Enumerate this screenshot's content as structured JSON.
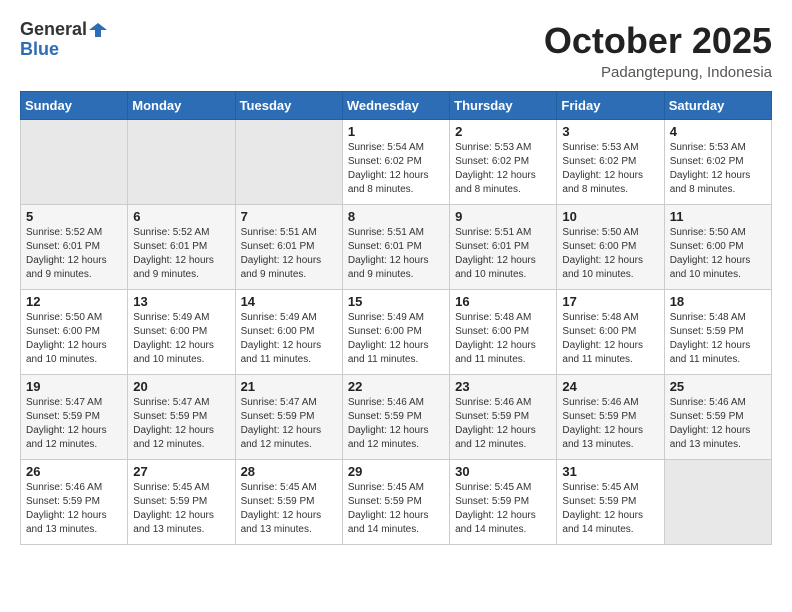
{
  "header": {
    "logo": {
      "general": "General",
      "blue": "Blue"
    },
    "title": "October 2025",
    "subtitle": "Padangtepung, Indonesia"
  },
  "weekdays": [
    "Sunday",
    "Monday",
    "Tuesday",
    "Wednesday",
    "Thursday",
    "Friday",
    "Saturday"
  ],
  "weeks": [
    [
      {
        "day": "",
        "empty": true
      },
      {
        "day": "",
        "empty": true
      },
      {
        "day": "",
        "empty": true
      },
      {
        "day": "1",
        "sunrise": "Sunrise: 5:54 AM",
        "sunset": "Sunset: 6:02 PM",
        "daylight": "Daylight: 12 hours and 8 minutes."
      },
      {
        "day": "2",
        "sunrise": "Sunrise: 5:53 AM",
        "sunset": "Sunset: 6:02 PM",
        "daylight": "Daylight: 12 hours and 8 minutes."
      },
      {
        "day": "3",
        "sunrise": "Sunrise: 5:53 AM",
        "sunset": "Sunset: 6:02 PM",
        "daylight": "Daylight: 12 hours and 8 minutes."
      },
      {
        "day": "4",
        "sunrise": "Sunrise: 5:53 AM",
        "sunset": "Sunset: 6:02 PM",
        "daylight": "Daylight: 12 hours and 8 minutes."
      }
    ],
    [
      {
        "day": "5",
        "sunrise": "Sunrise: 5:52 AM",
        "sunset": "Sunset: 6:01 PM",
        "daylight": "Daylight: 12 hours and 9 minutes."
      },
      {
        "day": "6",
        "sunrise": "Sunrise: 5:52 AM",
        "sunset": "Sunset: 6:01 PM",
        "daylight": "Daylight: 12 hours and 9 minutes."
      },
      {
        "day": "7",
        "sunrise": "Sunrise: 5:51 AM",
        "sunset": "Sunset: 6:01 PM",
        "daylight": "Daylight: 12 hours and 9 minutes."
      },
      {
        "day": "8",
        "sunrise": "Sunrise: 5:51 AM",
        "sunset": "Sunset: 6:01 PM",
        "daylight": "Daylight: 12 hours and 9 minutes."
      },
      {
        "day": "9",
        "sunrise": "Sunrise: 5:51 AM",
        "sunset": "Sunset: 6:01 PM",
        "daylight": "Daylight: 12 hours and 10 minutes."
      },
      {
        "day": "10",
        "sunrise": "Sunrise: 5:50 AM",
        "sunset": "Sunset: 6:00 PM",
        "daylight": "Daylight: 12 hours and 10 minutes."
      },
      {
        "day": "11",
        "sunrise": "Sunrise: 5:50 AM",
        "sunset": "Sunset: 6:00 PM",
        "daylight": "Daylight: 12 hours and 10 minutes."
      }
    ],
    [
      {
        "day": "12",
        "sunrise": "Sunrise: 5:50 AM",
        "sunset": "Sunset: 6:00 PM",
        "daylight": "Daylight: 12 hours and 10 minutes."
      },
      {
        "day": "13",
        "sunrise": "Sunrise: 5:49 AM",
        "sunset": "Sunset: 6:00 PM",
        "daylight": "Daylight: 12 hours and 10 minutes."
      },
      {
        "day": "14",
        "sunrise": "Sunrise: 5:49 AM",
        "sunset": "Sunset: 6:00 PM",
        "daylight": "Daylight: 12 hours and 11 minutes."
      },
      {
        "day": "15",
        "sunrise": "Sunrise: 5:49 AM",
        "sunset": "Sunset: 6:00 PM",
        "daylight": "Daylight: 12 hours and 11 minutes."
      },
      {
        "day": "16",
        "sunrise": "Sunrise: 5:48 AM",
        "sunset": "Sunset: 6:00 PM",
        "daylight": "Daylight: 12 hours and 11 minutes."
      },
      {
        "day": "17",
        "sunrise": "Sunrise: 5:48 AM",
        "sunset": "Sunset: 6:00 PM",
        "daylight": "Daylight: 12 hours and 11 minutes."
      },
      {
        "day": "18",
        "sunrise": "Sunrise: 5:48 AM",
        "sunset": "Sunset: 5:59 PM",
        "daylight": "Daylight: 12 hours and 11 minutes."
      }
    ],
    [
      {
        "day": "19",
        "sunrise": "Sunrise: 5:47 AM",
        "sunset": "Sunset: 5:59 PM",
        "daylight": "Daylight: 12 hours and 12 minutes."
      },
      {
        "day": "20",
        "sunrise": "Sunrise: 5:47 AM",
        "sunset": "Sunset: 5:59 PM",
        "daylight": "Daylight: 12 hours and 12 minutes."
      },
      {
        "day": "21",
        "sunrise": "Sunrise: 5:47 AM",
        "sunset": "Sunset: 5:59 PM",
        "daylight": "Daylight: 12 hours and 12 minutes."
      },
      {
        "day": "22",
        "sunrise": "Sunrise: 5:46 AM",
        "sunset": "Sunset: 5:59 PM",
        "daylight": "Daylight: 12 hours and 12 minutes."
      },
      {
        "day": "23",
        "sunrise": "Sunrise: 5:46 AM",
        "sunset": "Sunset: 5:59 PM",
        "daylight": "Daylight: 12 hours and 12 minutes."
      },
      {
        "day": "24",
        "sunrise": "Sunrise: 5:46 AM",
        "sunset": "Sunset: 5:59 PM",
        "daylight": "Daylight: 12 hours and 13 minutes."
      },
      {
        "day": "25",
        "sunrise": "Sunrise: 5:46 AM",
        "sunset": "Sunset: 5:59 PM",
        "daylight": "Daylight: 12 hours and 13 minutes."
      }
    ],
    [
      {
        "day": "26",
        "sunrise": "Sunrise: 5:46 AM",
        "sunset": "Sunset: 5:59 PM",
        "daylight": "Daylight: 12 hours and 13 minutes."
      },
      {
        "day": "27",
        "sunrise": "Sunrise: 5:45 AM",
        "sunset": "Sunset: 5:59 PM",
        "daylight": "Daylight: 12 hours and 13 minutes."
      },
      {
        "day": "28",
        "sunrise": "Sunrise: 5:45 AM",
        "sunset": "Sunset: 5:59 PM",
        "daylight": "Daylight: 12 hours and 13 minutes."
      },
      {
        "day": "29",
        "sunrise": "Sunrise: 5:45 AM",
        "sunset": "Sunset: 5:59 PM",
        "daylight": "Daylight: 12 hours and 14 minutes."
      },
      {
        "day": "30",
        "sunrise": "Sunrise: 5:45 AM",
        "sunset": "Sunset: 5:59 PM",
        "daylight": "Daylight: 12 hours and 14 minutes."
      },
      {
        "day": "31",
        "sunrise": "Sunrise: 5:45 AM",
        "sunset": "Sunset: 5:59 PM",
        "daylight": "Daylight: 12 hours and 14 minutes."
      },
      {
        "day": "",
        "empty": true
      }
    ]
  ]
}
